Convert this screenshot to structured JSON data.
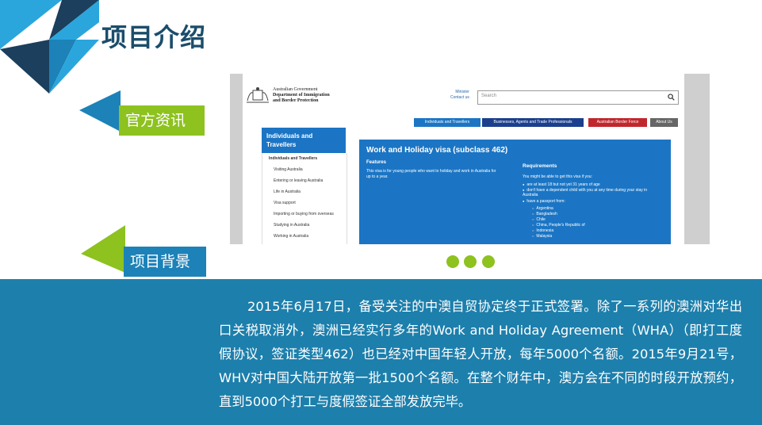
{
  "page": {
    "title": "项目介绍",
    "colors": {
      "dark_navy": "#1b3f5c",
      "accent_blue": "#1c82b8",
      "accent_green": "#8dc21f",
      "band_blue": "#1d7fac"
    }
  },
  "labels": {
    "official_info": "官方资讯",
    "project_background": "项目背景"
  },
  "screenshot": {
    "gov_line1": "Australian Government",
    "gov_line2": "Department of Immigration",
    "gov_line3": "and Border Protection",
    "minister": "Minister",
    "contact": "Contact us",
    "search_placeholder": "Search",
    "nav": [
      "Individuals and Travellers",
      "Businesses, Agents and Trade Professionals",
      "Australian Border Force",
      "About Us"
    ],
    "sidebar_head": "Individuals and Travellers",
    "sidebar_items": [
      "Individuals and Travellers",
      "Visiting Australia",
      "Entering or leaving Australia",
      "Life in Australia",
      "Visa support",
      "Importing or buying from overseas",
      "Studying in Australia",
      "Working in Australia"
    ],
    "visa_title": "Work and Holiday visa (subclass 462)",
    "features_heading": "Features",
    "features_text": "This visa is for young people who want to holiday and work in Australia for up to a year.",
    "requirements_heading": "Requirements",
    "requirements_intro": "You might be able to get this visa if you:",
    "requirements": [
      "are at least 18 but not yet 31 years of age",
      "don't have a dependent child with you at any time during your stay in Australia",
      "have a passport from:"
    ],
    "countries": [
      "Argentina",
      "Bangladesh",
      "Chile",
      "China, People's Republic of",
      "Indonesia",
      "Malaysia"
    ]
  },
  "carousel": {
    "dots": 3
  },
  "body": {
    "paragraph": "2015年6月17日，备受关注的中澳自贸协定终于正式签署。除了一系列的澳洲对华出口关税取消外，澳洲已经实行多年的Work and Holiday Agreement（WHA）（即打工度假协议，签证类型462）也已经对中国年轻人开放，每年5000个名额。2015年9月21号，WHV对中国大陆开放第一批1500个名额。在整个财年中，澳方会在不同的时段开放预约，直到5000个打工与度假签证全部发放完毕。"
  }
}
